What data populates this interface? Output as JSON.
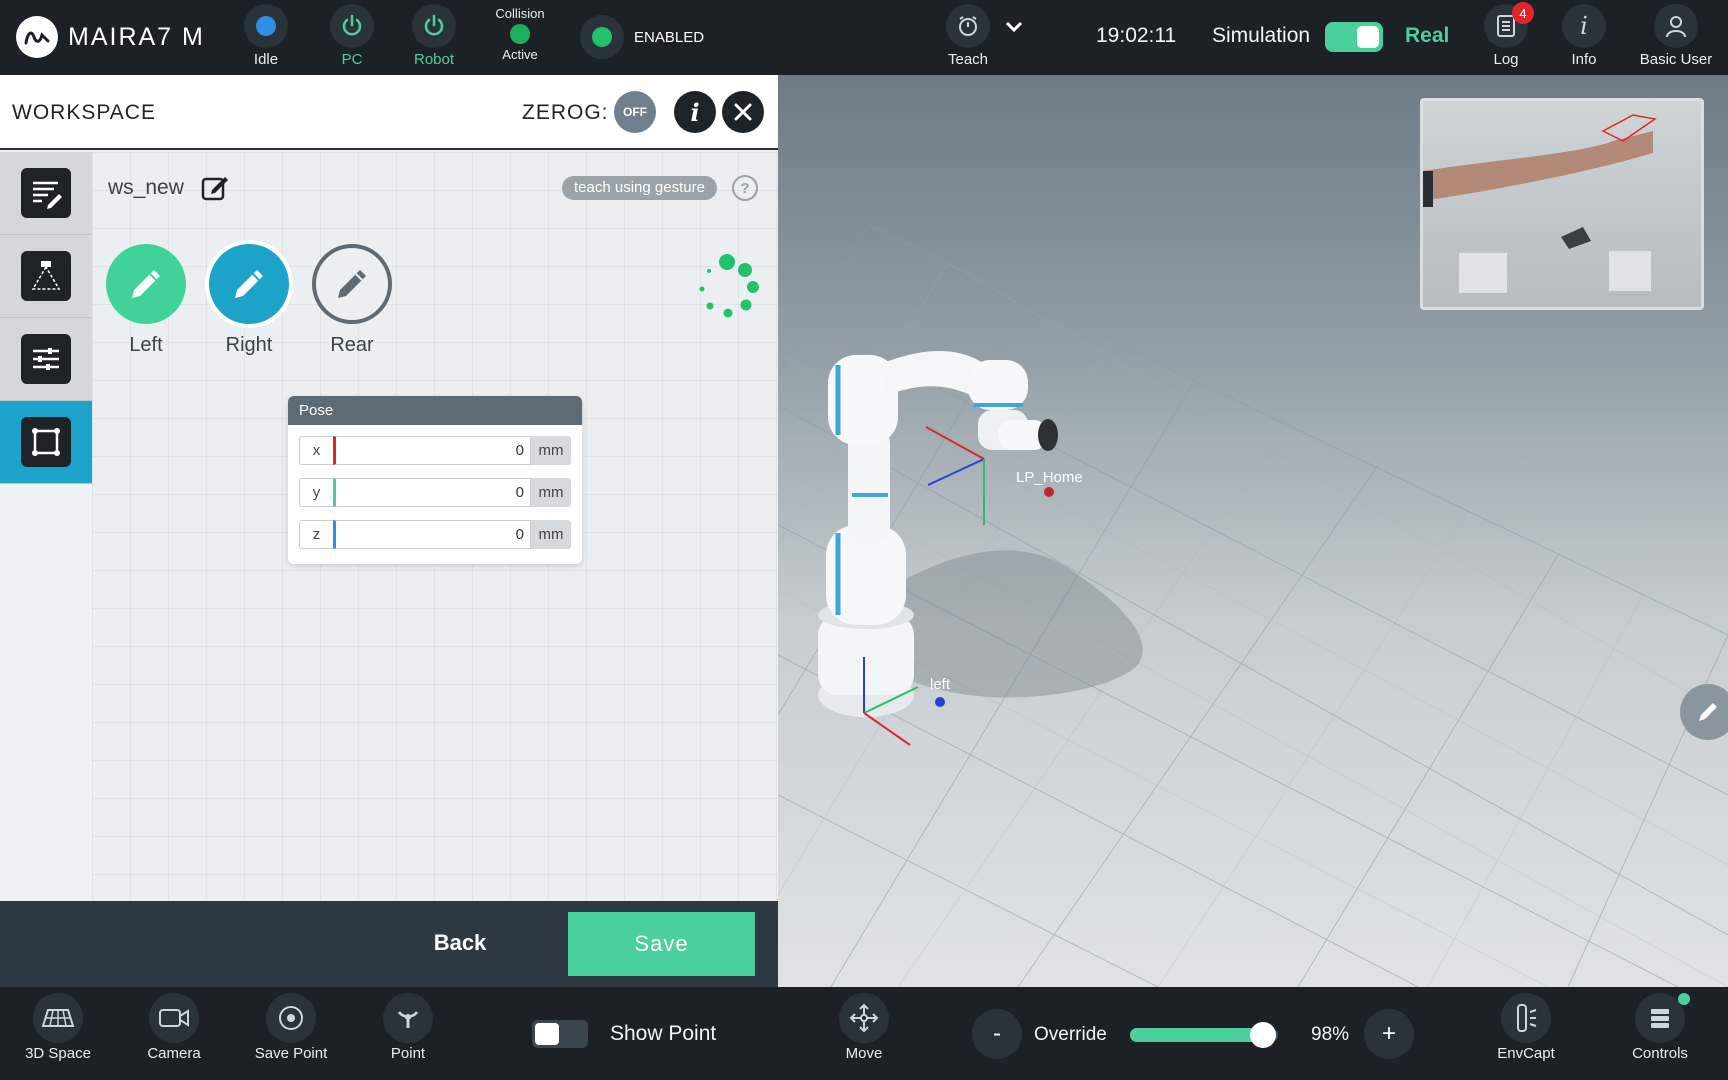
{
  "topbar": {
    "brand": "MAIRA7 M",
    "status_items": [
      {
        "label": "Idle",
        "color": "#2f8ee6",
        "label_color": "#e9edf0"
      },
      {
        "label": "PC",
        "color": "#4bcf9d",
        "label_color": "#4bcf9d"
      },
      {
        "label": "Robot",
        "color": "#4bcf9d",
        "label_color": "#4bcf9d"
      }
    ],
    "collision": {
      "title": "Collision",
      "state": "Active",
      "color": "#1fae5a"
    },
    "enabled": {
      "label": "ENABLED",
      "color": "#22c16b"
    },
    "teach_label": "Teach",
    "time": "19:02:11",
    "simulation_label": "Simulation",
    "simulation_enabled": true,
    "real_label": "Real",
    "log": {
      "label": "Log",
      "badge": "4"
    },
    "info_label": "Info",
    "user_label": "Basic User"
  },
  "panel": {
    "title": "WORKSPACE",
    "zerog_label": "ZEROG:",
    "zerog_state": "OFF",
    "workspace_name": "ws_new",
    "gesture_label": "teach using gesture",
    "help_label": "?",
    "sides": [
      {
        "label": "Left",
        "color": "#3fd39a",
        "state": "done"
      },
      {
        "label": "Right",
        "color": "#1da3c9",
        "state": "active"
      },
      {
        "label": "Rear",
        "color": "#eceff1",
        "state": "pending"
      }
    ],
    "pose": {
      "title": "Pose",
      "rows": [
        {
          "axis": "x",
          "value": "0",
          "unit": "mm",
          "color": "#e0262b"
        },
        {
          "axis": "y",
          "value": "0",
          "unit": "mm",
          "color": "#4bcf9d"
        },
        {
          "axis": "z",
          "value": "0",
          "unit": "mm",
          "color": "#2f8ee6"
        }
      ]
    },
    "back_label": "Back",
    "save_label": "Save"
  },
  "view3d": {
    "point_labels": [
      "LP_Home",
      "left"
    ],
    "accent": "#1da3c9"
  },
  "bottombar": {
    "items": [
      {
        "label": "3D Space"
      },
      {
        "label": "Camera"
      },
      {
        "label": "Save Point"
      },
      {
        "label": "Point"
      }
    ],
    "show_point_label": "Show Point",
    "show_point_enabled": false,
    "move_label": "Move",
    "override_label": "Override",
    "override_percent": 98,
    "override_value": "98%",
    "minus_label": "-",
    "plus_label": "+",
    "envcapt_label": "EnvCapt",
    "controls_label": "Controls"
  }
}
